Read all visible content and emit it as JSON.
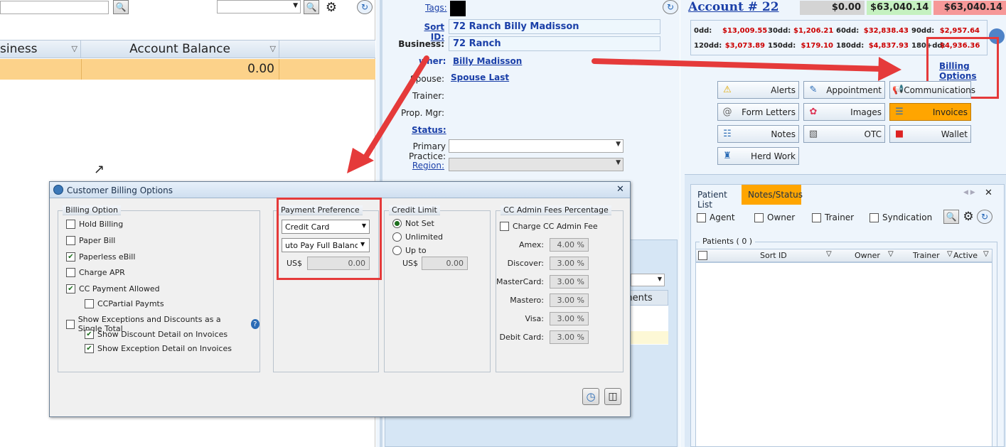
{
  "left_grid": {
    "columns": [
      "siness",
      "Account Balance"
    ],
    "rows": [
      {
        "business": "",
        "account_balance": "0.00"
      }
    ]
  },
  "middle": {
    "tags_label": "Tags:",
    "sort_id_label": "Sort ID:",
    "sort_id_value": "72 Ranch   Billy Madisson",
    "business_label": "Business:",
    "business_value": "72 Ranch",
    "owner_label": "wner:",
    "owner_value": "Billy Madisson",
    "spouse_label": "Spouse:",
    "spouse_value": "Spouse Last",
    "trainer_label": "Trainer:",
    "prop_mgr_label": "Prop. Mgr:",
    "status_label": "Status:",
    "primary_practice_label": "Primary Practice:",
    "region_label": "Region:",
    "behind_header": "ments"
  },
  "right": {
    "account_title": "Account # 22",
    "balances": [
      "$0.00",
      "$63,040.14",
      "$63,040.14"
    ],
    "aging_row1": [
      {
        "label": "0dd:",
        "value": "$13,009.55"
      },
      {
        "label": "30dd:",
        "value": "$1,206.21"
      },
      {
        "label": "60dd:",
        "value": "$32,838.43"
      },
      {
        "label": "90dd:",
        "value": "$2,957.64"
      }
    ],
    "aging_row2": [
      {
        "label": "120dd:",
        "value": "$3,073.89"
      },
      {
        "label": "150dd:",
        "value": "$179.10"
      },
      {
        "label": "180dd:",
        "value": "$4,837.93"
      },
      {
        "label": "180+dd:",
        "value": "$4,936.36"
      }
    ],
    "billing_options_link": "Billing Options",
    "action_buttons": [
      "Alerts",
      "Appointment",
      "Communications",
      "Form Letters",
      "Images",
      "Invoices",
      "Notes",
      "OTC",
      "Wallet",
      "Herd Work"
    ],
    "tabs": [
      "Patient List",
      "Notes/Status"
    ],
    "filters": [
      "Agent",
      "Owner",
      "Trainer",
      "Syndication"
    ],
    "patients_group": "Patients ( 0 )",
    "patient_columns": [
      "Sort ID",
      "Owner",
      "Trainer",
      "Active"
    ]
  },
  "dialog": {
    "title": "Customer Billing Options",
    "billing_option": {
      "title": "Billing Option",
      "items": [
        {
          "label": "Hold Billing",
          "checked": false
        },
        {
          "label": "Paper Bill",
          "checked": false
        },
        {
          "label": "Paperless eBill",
          "checked": true
        },
        {
          "label": "Charge APR",
          "checked": false
        },
        {
          "label": "CC Payment Allowed",
          "checked": true
        },
        {
          "label": "CCPartial Paymts",
          "checked": false
        },
        {
          "label": "Show Exceptions and Discounts as a Single Total",
          "checked": false
        },
        {
          "label": "Show Discount Detail on Invoices",
          "checked": true
        },
        {
          "label": "Show Exception Detail on Invoices",
          "checked": true
        }
      ]
    },
    "payment_preference": {
      "title": "Payment Preference",
      "method": "Credit Card",
      "auto_pay": "uto Pay Full Balance",
      "currency_label": "US$",
      "amount": "0.00"
    },
    "credit_limit": {
      "title": "Credit Limit",
      "options": [
        "Not Set",
        "Unlimited",
        "Up to"
      ],
      "selected": "Not Set",
      "currency_label": "US$",
      "amount": "0.00"
    },
    "cc_admin": {
      "title": "CC Admin Fees Percentage",
      "charge_label": "Charge CC Admin Fee",
      "cards": [
        {
          "label": "Amex:",
          "value": "4.00 %"
        },
        {
          "label": "Discover:",
          "value": "3.00 %"
        },
        {
          "label": "MasterCard:",
          "value": "3.00 %"
        },
        {
          "label": "Mastero:",
          "value": "3.00 %"
        },
        {
          "label": "Visa:",
          "value": "3.00 %"
        },
        {
          "label": "Debit Card:",
          "value": "3.00 %"
        }
      ]
    }
  },
  "colors": {
    "annotation_red": "#e53a3a",
    "invoices_orange": "#ffa500",
    "row_highlight": "#fcd28a"
  }
}
